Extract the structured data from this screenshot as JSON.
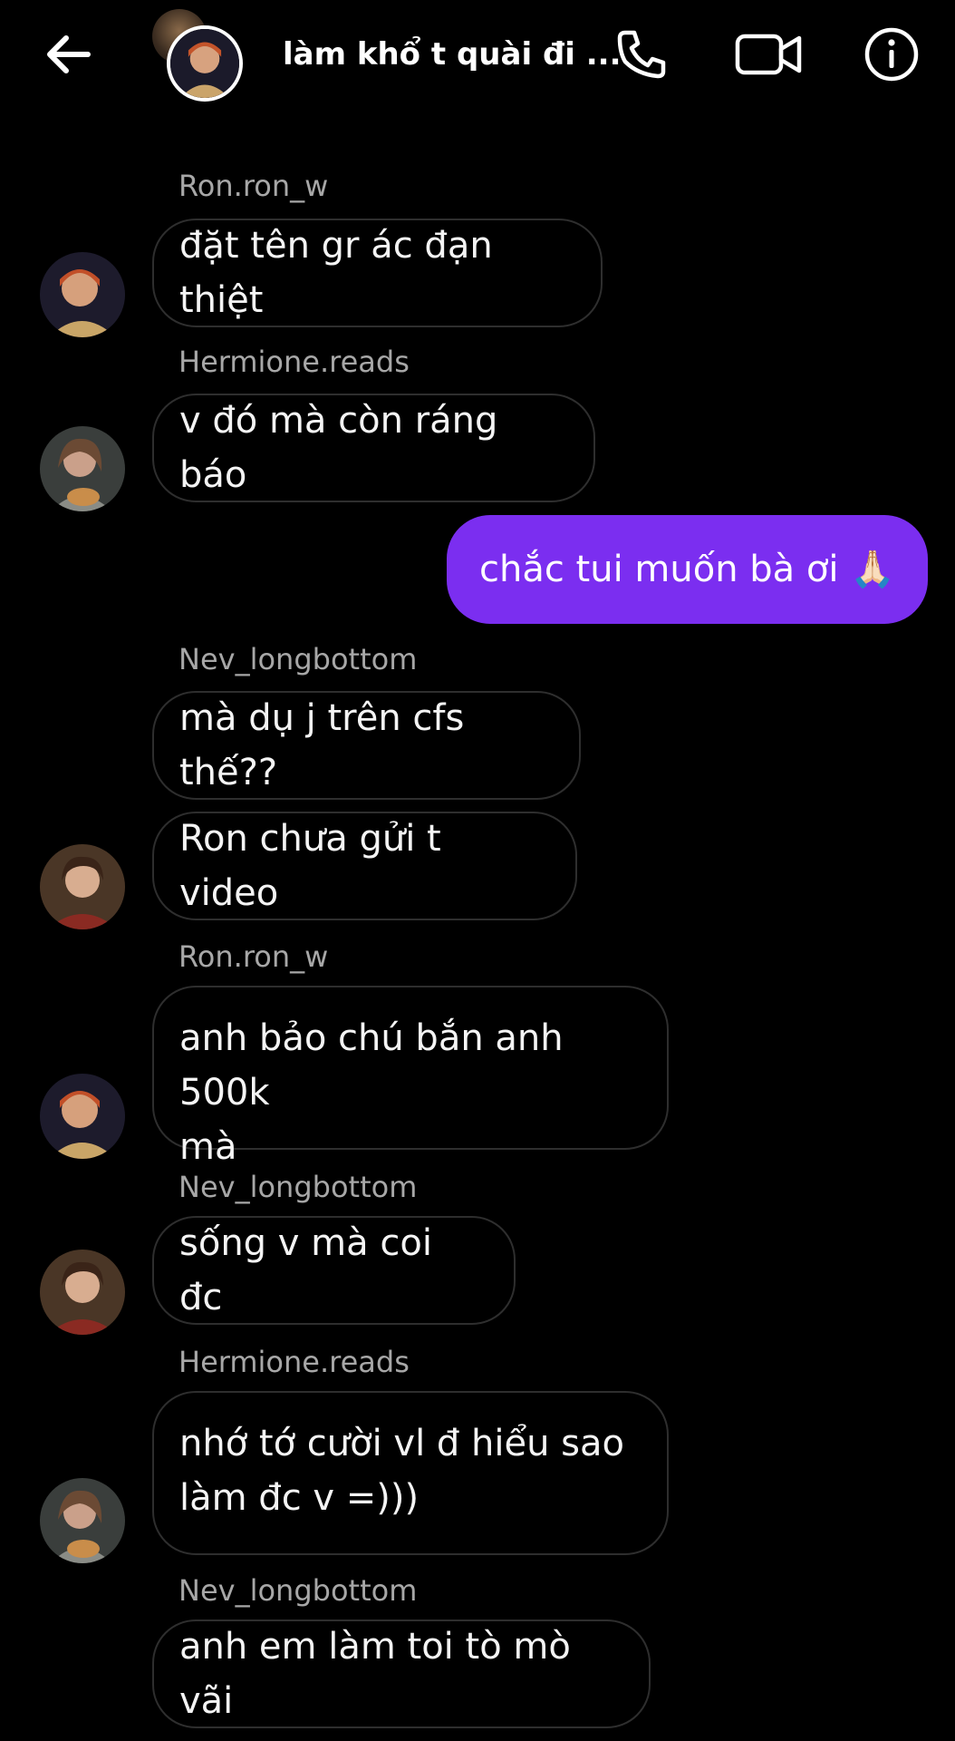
{
  "header": {
    "title": "làm khổ t quài đi ...",
    "back_icon": "arrow-left-icon",
    "call_icon": "phone-icon",
    "video_icon": "video-camera-icon",
    "info_icon": "info-icon"
  },
  "colors": {
    "background": "#000000",
    "my_bubble": "#7b2ef0",
    "bubble_border": "#2e2e2e",
    "sender_text": "#a7a7a7"
  },
  "messages": [
    {
      "sender": "Ron.ron_w",
      "text": "đặt tên gr ác đạn thiệt"
    },
    {
      "sender": "Hermione.reads",
      "text": "v đó mà còn ráng báo"
    },
    {
      "sender": "",
      "text": "chắc tui muốn bà ơi 🙏🏻"
    },
    {
      "sender": "Nev_longbottom",
      "text": "mà dụ j trên cfs thế??"
    },
    {
      "sender": "",
      "text": "Ron chưa gửi t video"
    },
    {
      "sender": "Ron.ron_w",
      "text_line1": "anh bảo chú bắn anh 500k",
      "text_line2": "mà"
    },
    {
      "sender": "Nev_longbottom",
      "text": "sống v mà coi đc"
    },
    {
      "sender": "Hermione.reads",
      "text_line1": "nhớ tớ cười vl đ hiểu sao",
      "text_line2": "làm đc v =)))"
    },
    {
      "sender": "Nev_longbottom",
      "text": "anh em làm toi tò mò vãi"
    }
  ]
}
